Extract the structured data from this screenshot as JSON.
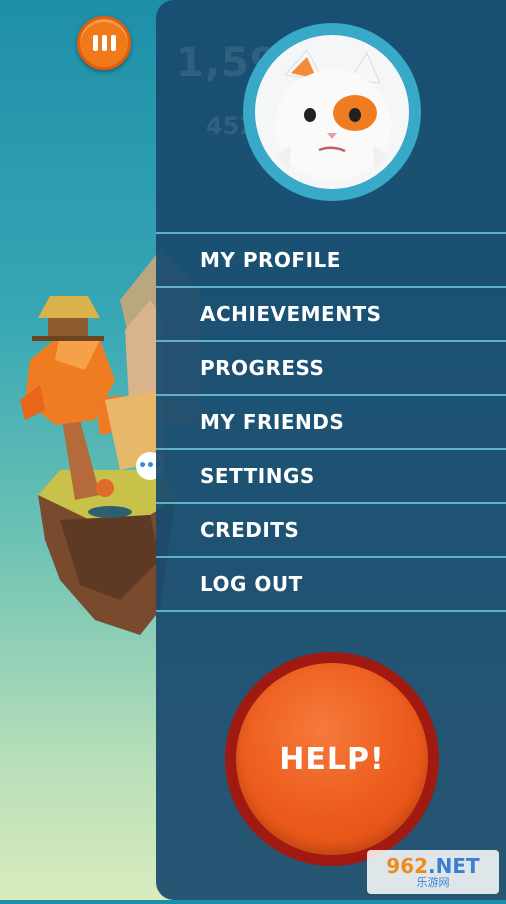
{
  "background": {
    "score_main": "1,594",
    "score_sub": "452"
  },
  "pause_button": {
    "icon": "pause-icon"
  },
  "speech_bubble": {
    "icon": "speech-bubble-icon",
    "text": "•••"
  },
  "profile": {
    "avatar_icon": "white-cat-avatar"
  },
  "menu": {
    "items": [
      {
        "label": "MY PROFILE"
      },
      {
        "label": "ACHIEVEMENTS"
      },
      {
        "label": "PROGRESS"
      },
      {
        "label": "MY FRIENDS"
      },
      {
        "label": "SETTINGS"
      },
      {
        "label": "CREDITS"
      },
      {
        "label": "LOG OUT"
      }
    ]
  },
  "help_button": {
    "label": "HELP!"
  },
  "watermark": {
    "main": "962",
    "suffix": ".NET",
    "sub": "乐游网"
  },
  "colors": {
    "panel": "#194a6e",
    "divider": "#5fb0c9",
    "help_orange": "#ec5a1c",
    "help_ring": "#a01a12",
    "pause_orange": "#f07a1a"
  }
}
